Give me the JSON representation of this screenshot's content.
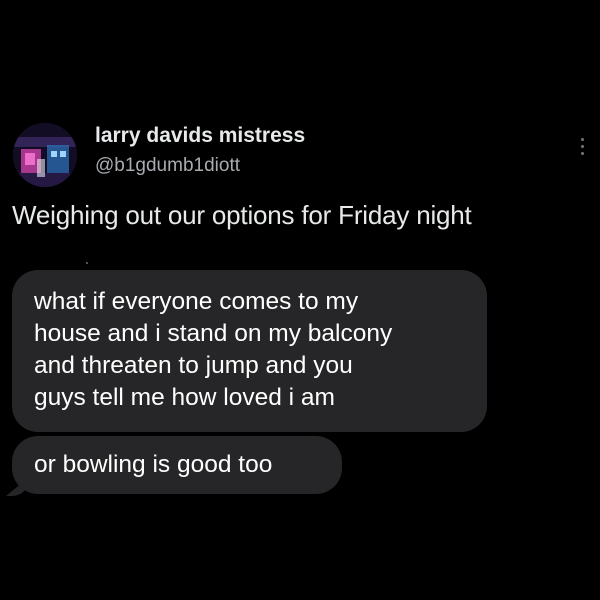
{
  "author": {
    "display_name": "larry davids mistress",
    "handle": "@b1gdumb1diott"
  },
  "tweet": {
    "text": "Weighing out our options for Friday night"
  },
  "screenshot_messages": {
    "message_1_lines": [
      "what if everyone comes to my",
      "house and i stand on my balcony",
      "and threaten to jump and you",
      "guys tell me how loved i am"
    ],
    "message_2": "or bowling is good too"
  },
  "colors": {
    "background": "#000000",
    "name_text": "#e7e9ea",
    "handle_text": "#a8acb0",
    "bubble": "#262628",
    "bubble_text": "#ffffff"
  },
  "icons": {
    "more": "more-options-icon"
  }
}
